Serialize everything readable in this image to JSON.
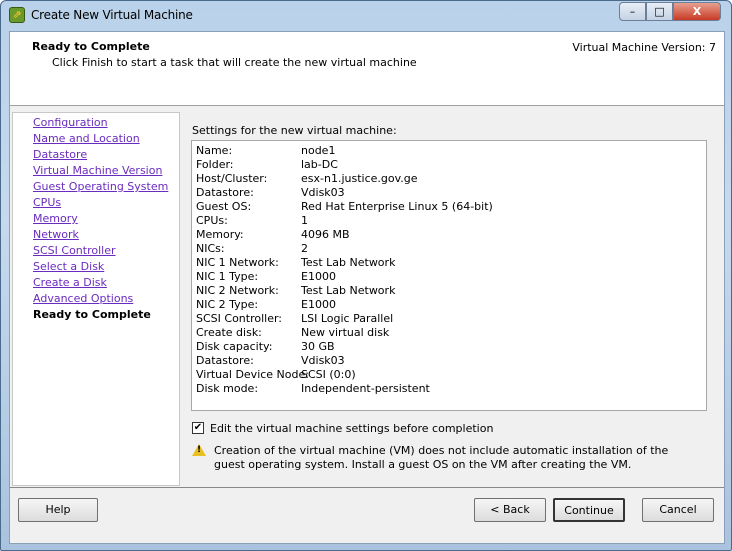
{
  "window": {
    "title": "Create New Virtual Machine",
    "minimize": "–",
    "maximize": "□",
    "close": "X"
  },
  "header": {
    "title": "Ready to Complete",
    "subtitle": "Click Finish to start a task that will create the new virtual machine",
    "version": "Virtual Machine Version: 7"
  },
  "nav": [
    "Configuration",
    "Name and Location",
    "Datastore",
    "Virtual Machine Version",
    "Guest Operating System",
    "CPUs",
    "Memory",
    "Network",
    "SCSI Controller",
    "Select a Disk",
    "Create a Disk",
    "Advanced Options",
    "Ready to Complete"
  ],
  "settings_label": "Settings for the new virtual machine:",
  "settings": [
    [
      "Name:",
      "node1"
    ],
    [
      "Folder:",
      "lab-DC"
    ],
    [
      "Host/Cluster:",
      "esx-n1.justice.gov.ge"
    ],
    [
      "Datastore:",
      "Vdisk03"
    ],
    [
      "Guest OS:",
      "Red Hat Enterprise Linux 5 (64-bit)"
    ],
    [
      "CPUs:",
      "1"
    ],
    [
      "Memory:",
      "4096 MB"
    ],
    [
      "NICs:",
      "2"
    ],
    [
      "NIC 1 Network:",
      "Test Lab Network"
    ],
    [
      "NIC 1 Type:",
      "E1000"
    ],
    [
      "NIC 2 Network:",
      "Test Lab Network"
    ],
    [
      "NIC 2 Type:",
      "E1000"
    ],
    [
      "SCSI Controller:",
      "LSI Logic Parallel"
    ],
    [
      "Create disk:",
      "New virtual disk"
    ],
    [
      "Disk capacity:",
      "30 GB"
    ],
    [
      "Datastore:",
      "Vdisk03"
    ],
    [
      "Virtual Device Node:",
      "SCSI (0:0)"
    ],
    [
      "Disk mode:",
      "Independent-persistent"
    ]
  ],
  "edit_checkbox": {
    "label": "Edit the virtual machine settings before completion",
    "checked": true,
    "mark": "✔"
  },
  "warning": "Creation of the virtual machine (VM) does not include automatic installation of the guest operating system. Install a guest OS on the VM after creating the VM.",
  "buttons": {
    "help": "Help",
    "back": "< Back",
    "continue": "Continue",
    "cancel": "Cancel"
  }
}
